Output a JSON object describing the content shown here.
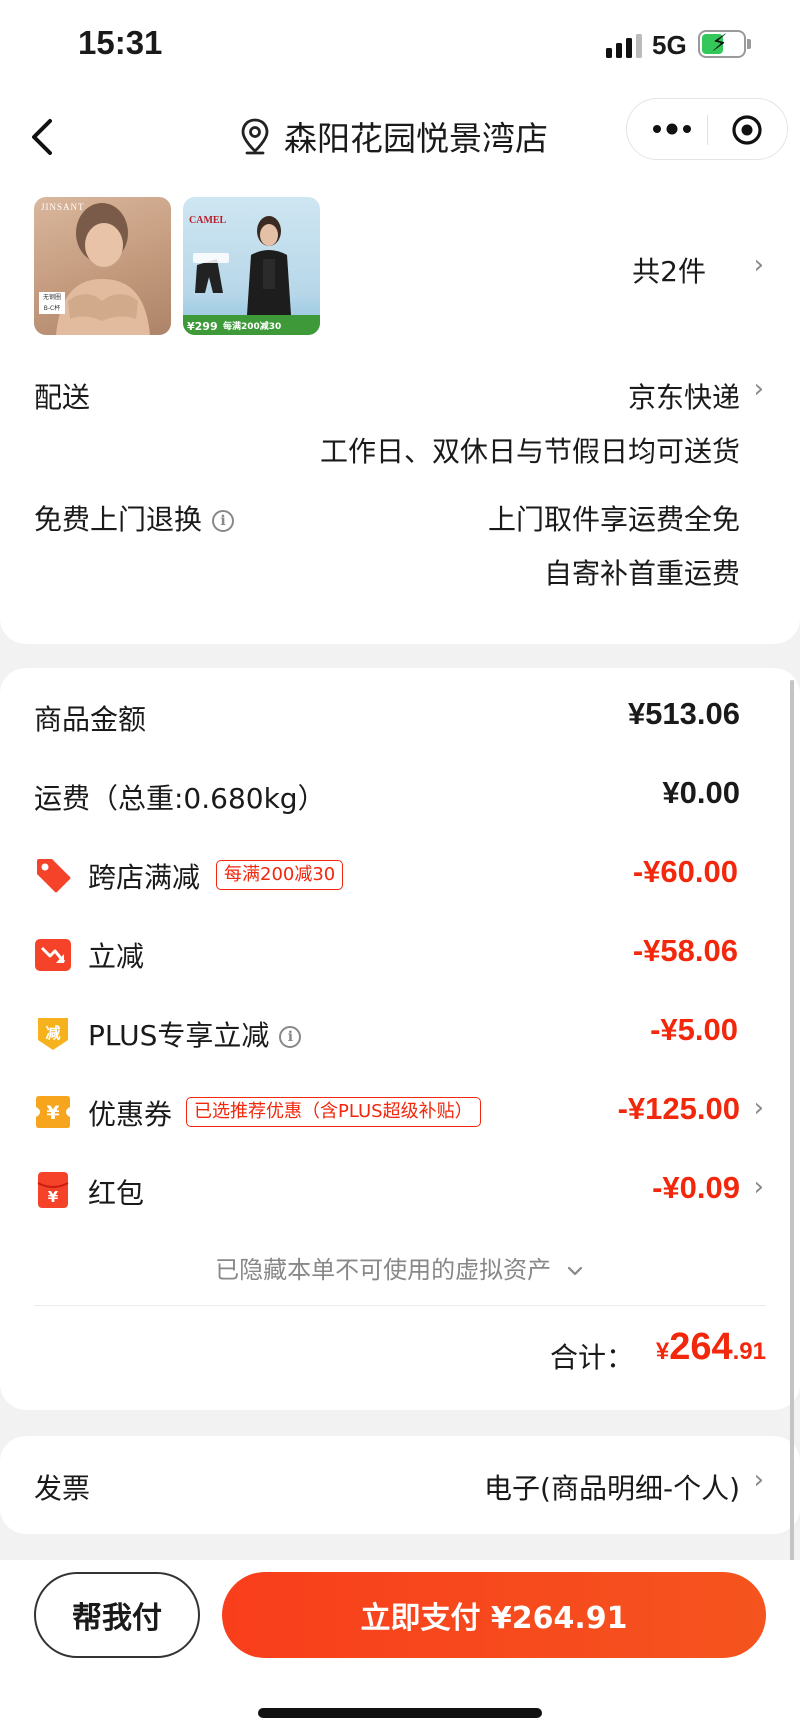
{
  "status_bar": {
    "time": "15:31",
    "network": "5G"
  },
  "nav": {
    "title": "森阳花园悦景湾店"
  },
  "products": {
    "item1": {
      "brand": "JINSANT",
      "tag_line1": "无钢圈",
      "tag_line2": "B-C杯"
    },
    "item2": {
      "brand": "CAMEL",
      "price": "¥299",
      "promo": "每满200减30"
    },
    "count_label": "共2件"
  },
  "delivery": {
    "label": "配送",
    "carrier": "京东快递",
    "schedule": "工作日、双休日与节假日均可送货"
  },
  "returns": {
    "label": "免费上门退换",
    "line1": "上门取件享运费全免",
    "line2": "自寄补首重运费"
  },
  "summary": {
    "goods_label": "商品金额",
    "goods_amount": "¥513.06",
    "shipping_label": "运费（总重:0.680kg）",
    "shipping_amount": "¥0.00"
  },
  "discounts": {
    "cross_store": {
      "label": "跨店满减",
      "badge": "每满200减30",
      "amount": "-¥60.00"
    },
    "instant": {
      "label": "立减",
      "amount": "-¥58.06"
    },
    "plus": {
      "icon_text": "减",
      "label": "PLUS专享立减",
      "amount": "-¥5.00"
    },
    "coupon": {
      "icon_text": "¥",
      "label": "优惠券",
      "badge": "已选推荐优惠（含PLUS超级补贴）",
      "amount": "-¥125.00"
    },
    "red_packet": {
      "icon_text": "¥",
      "label": "红包",
      "amount": "-¥0.09"
    }
  },
  "hidden_note": "已隐藏本单不可使用的虚拟资产",
  "total": {
    "label": "合计：",
    "currency": "¥",
    "integer": "264",
    "decimal": ".91"
  },
  "invoice": {
    "label": "发票",
    "value": "电子(商品明细-个人)"
  },
  "bottom": {
    "help_pay": "帮我付",
    "pay_now": "立即支付 ¥264.91"
  },
  "colors": {
    "accent_red": "#f2270c",
    "pay_gradient_start": "#f93e1c",
    "pay_gradient_end": "#f5541e"
  }
}
